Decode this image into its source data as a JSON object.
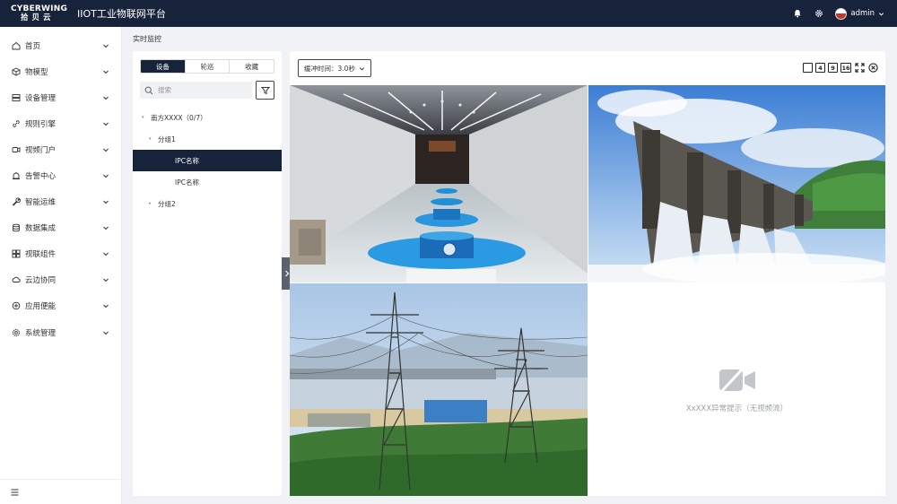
{
  "header": {
    "logo_en": "CYBERWING",
    "logo_cn": "拾贝云",
    "title": "IIOT工业物联网平台",
    "user": "admin"
  },
  "sidebar": {
    "items": [
      {
        "label": "首页",
        "icon": "home-icon"
      },
      {
        "label": "物模型",
        "icon": "cube-icon"
      },
      {
        "label": "设备管理",
        "icon": "server-icon"
      },
      {
        "label": "规则引擎",
        "icon": "link-icon"
      },
      {
        "label": "视频门户",
        "icon": "video-icon"
      },
      {
        "label": "告警中心",
        "icon": "alarm-icon"
      },
      {
        "label": "智能运维",
        "icon": "wrench-icon"
      },
      {
        "label": "数据集成",
        "icon": "database-icon"
      },
      {
        "label": "视联组件",
        "icon": "components-icon"
      },
      {
        "label": "云边协同",
        "icon": "cloud-icon"
      },
      {
        "label": "应用便能",
        "icon": "apps-icon"
      },
      {
        "label": "系统管理",
        "icon": "settings-icon"
      }
    ]
  },
  "breadcrumb": "实时监控",
  "left_panel": {
    "tabs": [
      "设备",
      "轮巡",
      "收藏"
    ],
    "active_tab": 0,
    "search_placeholder": "搜索",
    "tree": [
      {
        "label": "南方XXXX（0/7）",
        "level": 0,
        "caret": "▾"
      },
      {
        "label": "分组1",
        "level": 1,
        "caret": "▾"
      },
      {
        "label": "IPC名称",
        "level": 2,
        "caret": "",
        "selected": true
      },
      {
        "label": "IPC名称",
        "level": 2,
        "caret": ""
      },
      {
        "label": "分组2",
        "level": 1,
        "caret": "▸"
      }
    ]
  },
  "right_panel": {
    "buffer_label": "缓冲时间：3.0秒",
    "layout_options": [
      "",
      "4",
      "9",
      "16"
    ],
    "error_message": "XxXXX异常提示（无视频流）",
    "cells": [
      {
        "name": "hydropower-hall"
      },
      {
        "name": "dam-spillway"
      },
      {
        "name": "power-towers"
      },
      {
        "name": "no-stream"
      }
    ]
  },
  "colors": {
    "header_bg": "#16233a",
    "accent": "#16233a",
    "panel_bg": "#ffffff",
    "page_bg": "#f0f2f5"
  }
}
